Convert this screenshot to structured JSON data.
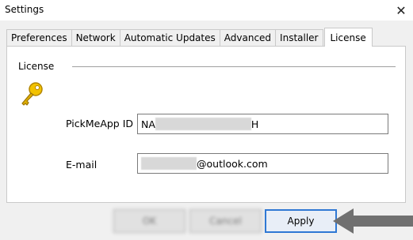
{
  "window": {
    "title": "Settings",
    "close_glyph": "✕"
  },
  "tabs": [
    {
      "label": "Preferences"
    },
    {
      "label": "Network"
    },
    {
      "label": "Automatic Updates"
    },
    {
      "label": "Advanced"
    },
    {
      "label": "Installer"
    },
    {
      "label": "License",
      "active": true
    }
  ],
  "license": {
    "group_label": "License",
    "icon": "key-icon",
    "id_label": "PickMeApp ID",
    "id_value_prefix": "NA",
    "id_value_suffix": "H",
    "email_label": "E-mail",
    "email_value_suffix": "@outlook.com"
  },
  "buttons": {
    "ok": "OK",
    "cancel": "Cancel",
    "apply": "Apply"
  },
  "annotation": {
    "icon": "arrow-left-icon",
    "color": "#707070"
  },
  "colors": {
    "accent": "#2f78d4",
    "key_gold": "#e0b000"
  }
}
